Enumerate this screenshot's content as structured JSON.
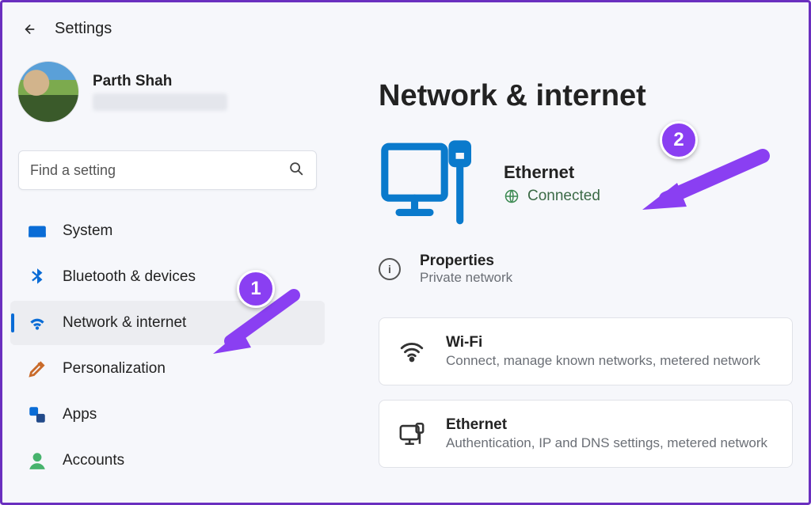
{
  "app": {
    "title": "Settings"
  },
  "user": {
    "name": "Parth Shah"
  },
  "search": {
    "placeholder": "Find a setting"
  },
  "sidebar": {
    "items": [
      {
        "label": "System"
      },
      {
        "label": "Bluetooth & devices"
      },
      {
        "label": "Network & internet"
      },
      {
        "label": "Personalization"
      },
      {
        "label": "Apps"
      },
      {
        "label": "Accounts"
      }
    ]
  },
  "page": {
    "title": "Network & internet",
    "hero": {
      "title": "Ethernet",
      "status": "Connected"
    },
    "properties": {
      "title": "Properties",
      "subtitle": "Private network"
    },
    "cards": [
      {
        "title": "Wi-Fi",
        "subtitle": "Connect, manage known networks, metered network"
      },
      {
        "title": "Ethernet",
        "subtitle": "Authentication, IP and DNS settings, metered network"
      }
    ]
  },
  "annotations": {
    "badge1": "1",
    "badge2": "2"
  }
}
